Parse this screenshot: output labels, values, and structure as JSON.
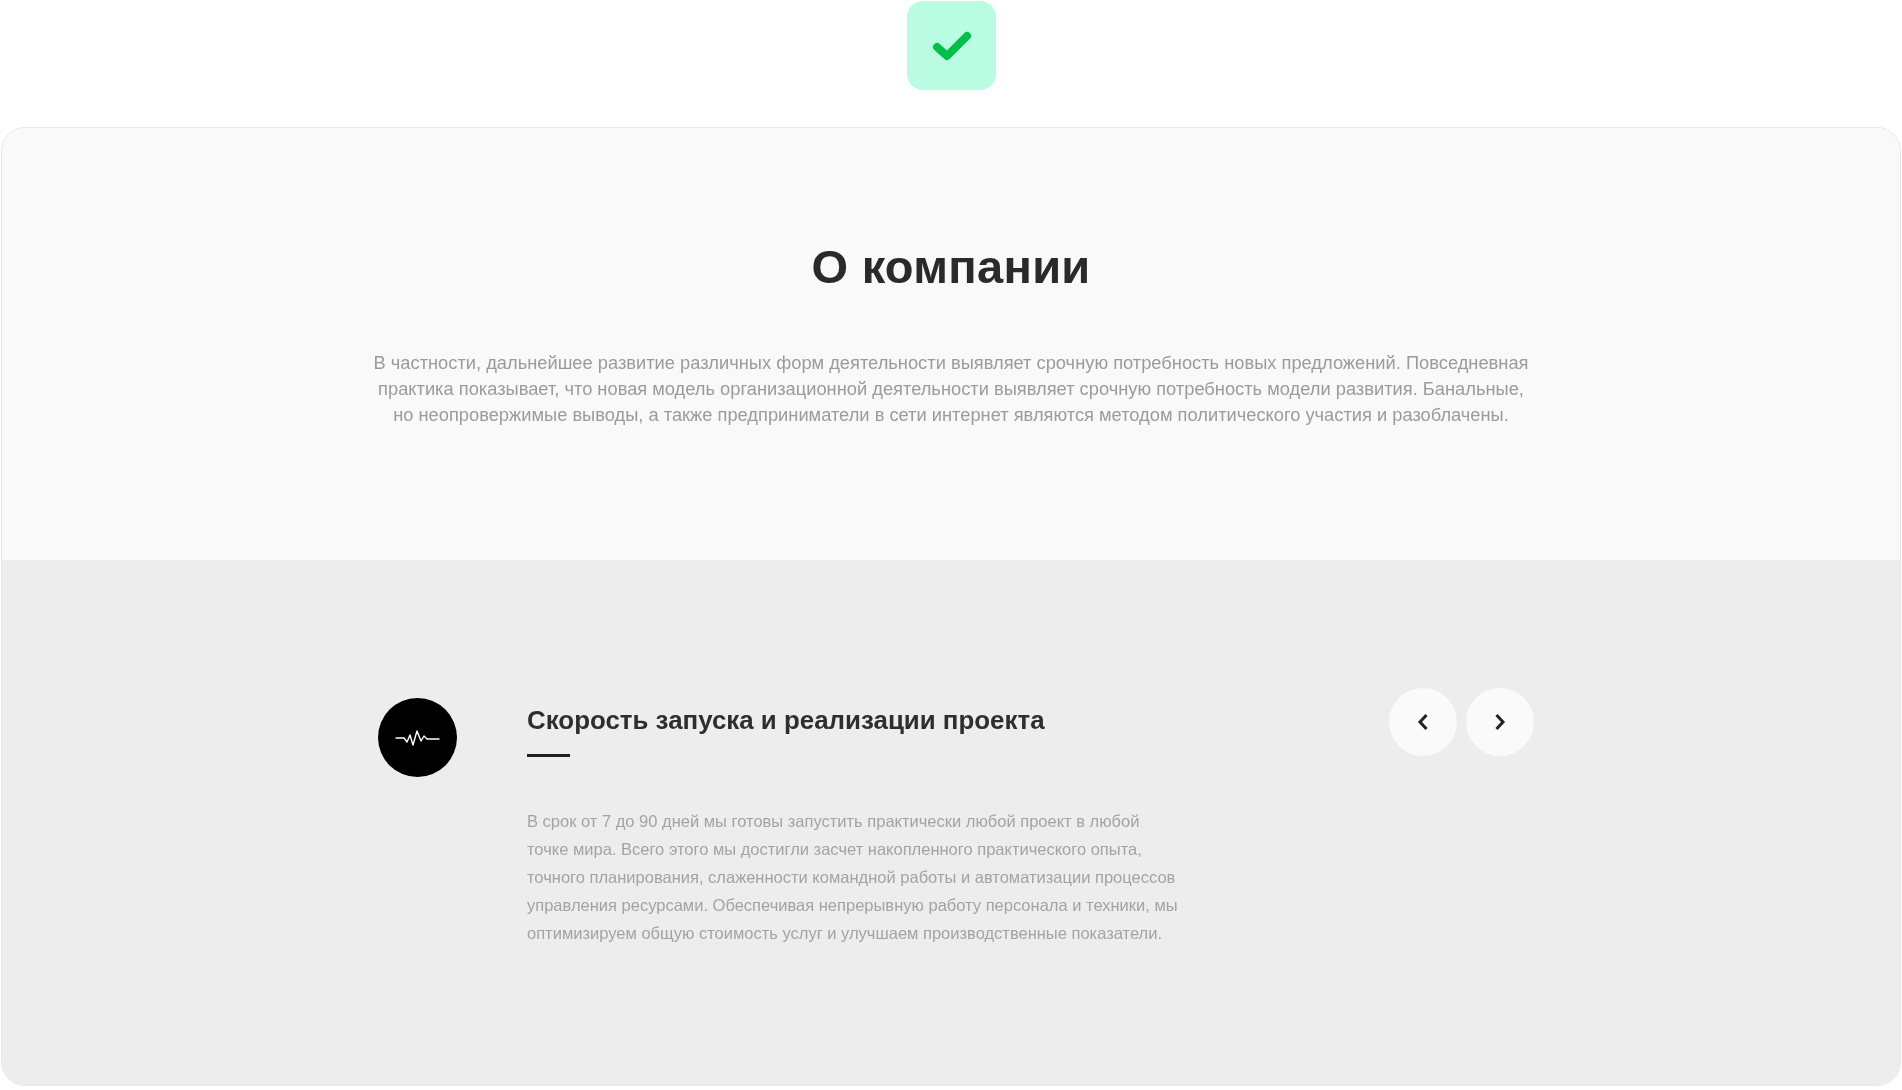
{
  "about": {
    "title": "О компании",
    "text": "В частности, дальнейшее развитие различных форм деятельности выявляет срочную потребность новых предложений. Повседневная практика показывает, что новая модель организационной деятельности выявляет срочную потребность модели развития. Банальные, но неопровержимые выводы, а также предприниматели в сети интернет являются методом политического участия и разоблачены."
  },
  "feature": {
    "title": "Скорость запуска и реализации проекта",
    "text": "В срок от 7 до 90 дней мы готовы запустить практически любой проект в любой точке мира. Всего этого мы достигли засчет накопленного практического опыта, точного планирования, слаженности командной работы и автоматизации процессов управления ресурсами. Обеспечивая непрерывную работу персонала и техники, мы оптимизируем общую стоимость услуг и улучшаем производственные показатели."
  }
}
